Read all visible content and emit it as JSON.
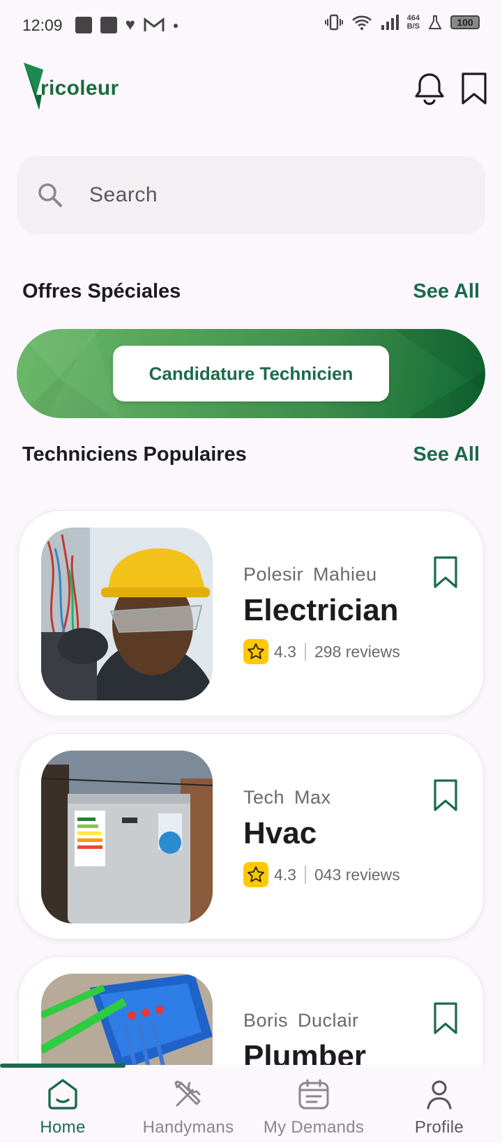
{
  "status_bar": {
    "time": "12:09",
    "net_speed_value": "464",
    "net_speed_unit": "B/S",
    "battery": "100"
  },
  "header": {
    "logo_text": "ricoleur"
  },
  "search": {
    "placeholder": "Search"
  },
  "special_offers": {
    "title": "Offres Spéciales",
    "see_all": "See All",
    "banner_button": "Candidature Technicien"
  },
  "popular": {
    "title": "Techniciens Populaires",
    "see_all": "See All",
    "technicians": [
      {
        "name": "Polesir  Mahieu",
        "trade": "Electrician",
        "rating": "4.3",
        "reviews": "298 reviews"
      },
      {
        "name": "Tech  Max",
        "trade": "Hvac",
        "rating": "4.3",
        "reviews": "043 reviews"
      },
      {
        "name": "Boris  Duclair",
        "trade": "Plumber",
        "rating": "",
        "reviews": ""
      }
    ]
  },
  "nav": {
    "items": [
      {
        "label": "Home",
        "active": true
      },
      {
        "label": "Handymans",
        "active": false
      },
      {
        "label": "My Demands",
        "active": false
      },
      {
        "label": "Profile",
        "active": false
      }
    ]
  },
  "colors": {
    "brand_green": "#1b6b4a",
    "star_yellow": "#ffc800"
  }
}
